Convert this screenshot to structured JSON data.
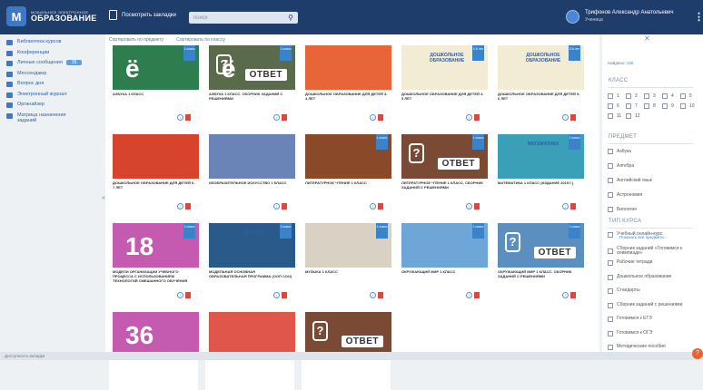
{
  "app": {
    "logo_small": "МОБИЛЬНОЕ ЭЛЕКТРОННОЕ",
    "logo_big": "ОБРАЗОВАНИЕ"
  },
  "header": {
    "bookmarks_label": "Посмотреть закладки",
    "search_placeholder": "поиск",
    "user_name": "Трифонов Александр Анатольевич",
    "user_role": "Ученица"
  },
  "sidebar": {
    "items": [
      {
        "label": "Библиотека курсов",
        "icon": "library-icon"
      },
      {
        "label": "Конференции",
        "icon": "conference-icon"
      },
      {
        "label": "Личные сообщения",
        "icon": "messages-icon",
        "badge": "15"
      },
      {
        "label": "Мессенджер",
        "icon": "messenger-icon"
      },
      {
        "label": "Вопрос дня",
        "icon": "question-icon"
      },
      {
        "label": "Электронный журнал",
        "icon": "journal-icon"
      },
      {
        "label": "Органайзер",
        "icon": "organizer-icon"
      },
      {
        "label": "Матрица назначения заданий",
        "icon": "matrix-icon"
      }
    ]
  },
  "sort": {
    "by_subject": "Сортировать по предмету",
    "by_class": "Сортировать по классу"
  },
  "cards": [
    {
      "title": "АЗБУКА 1 КЛАСС",
      "bg": "#2e7d4f",
      "big": "ё",
      "answer": false,
      "corner": "1 класс"
    },
    {
      "title": "АЗБУКА 1 КЛАСС. СБОРНИК ЗАДАНИЙ С РЕШЕНИЯМИ",
      "bg": "#5a6b4c",
      "big": "ё",
      "answer": true,
      "corner": "1 класс"
    },
    {
      "title": "ДОШКОЛЬНОЕ ОБРАЗОВАНИЕ ДЛЯ ДЕТЕЙ 3-4 ЛЕТ",
      "bg": "#e8653a",
      "big": "",
      "answer": false,
      "corner": ""
    },
    {
      "title": "ДОШКОЛЬНОЕ ОБРАЗОВАНИЕ ДЛЯ ДЕТЕЙ 4-5 ЛЕТ",
      "bg": "#f3ecd4",
      "big": "ДОШКОЛЬНОЕ ОБРАЗОВАНИЕ",
      "answer": false,
      "corner": "4-5 лет"
    },
    {
      "title": "ДОШКОЛЬНОЕ ОБРАЗОВАНИЕ ДЛЯ ДЕТЕЙ 5-6 ЛЕТ",
      "bg": "#f3ecd4",
      "big": "ДОШКОЛЬНОЕ ОБРАЗОВАНИЕ",
      "answer": false,
      "corner": "5-6 лет"
    },
    {
      "title": "ДОШКОЛЬНОЕ ОБРАЗОВАНИЕ ДЛЯ ДЕТЕЙ 6-7 ЛЕТ",
      "bg": "#d8432e",
      "big": "",
      "answer": false,
      "corner": ""
    },
    {
      "title": "ИЗОБРАЗИТЕЛЬНОЕ ИСКУССТВО 1 КЛАСС",
      "bg": "#6b84b8",
      "big": "",
      "answer": false,
      "corner": ""
    },
    {
      "title": "ЛИТЕРАТУРНОЕ ЧТЕНИЕ 1 КЛАСС",
      "bg": "#8a4a2a",
      "big": "",
      "answer": false,
      "corner": "1 класс"
    },
    {
      "title": "ЛИТЕРАТУРНОЕ ЧТЕНИЕ 1 КЛАСС. СБОРНИК ЗАДАНИЙ С РЕШЕНИЯМИ",
      "bg": "#7a4a35",
      "big": "",
      "answer": true,
      "corner": "1 класс"
    },
    {
      "title": "МАТЕМАТИКА 1 КЛАСС (ИЗДАНИЕ 2019 Г.)",
      "bg": "#3aa0b8",
      "big": "МАТЕМАТИКА",
      "answer": false,
      "corner": "1 класс"
    },
    {
      "title": "МОДЕЛИ ОРГАНИЗАЦИИ УЧЕБНОГО ПРОЦЕССА С ИСПОЛЬЗОВАНИЕМ ТЕХНОЛОГИЙ СМЕШАННОГО ОБУЧЕНИЯ",
      "bg": "#c45bb0",
      "big": "18",
      "answer": false,
      "corner": "1 класс"
    },
    {
      "title": "МОДЕЛЬНАЯ ОСНОВНАЯ ОБРАЗОВАТЕЛЬНАЯ ПРОГРАММА (ООП СОО)",
      "bg": "#2a5a8a",
      "big": "ООП СОО",
      "answer": false,
      "corner": "1 класс"
    },
    {
      "title": "МУЗЫКА 1 КЛАСС",
      "bg": "#d9d2c4",
      "big": "",
      "answer": false,
      "corner": "1 класс"
    },
    {
      "title": "ОКРУЖАЮЩИЙ МИР 1 КЛАСС",
      "bg": "#6fa6d8",
      "big": "",
      "answer": false,
      "corner": "1 класс"
    },
    {
      "title": "ОКРУЖАЮЩИЙ МИР 1 КЛАСС. СБОРНИК ЗАДАНИЙ С РЕШЕНИЯМИ",
      "bg": "#5a8fbf",
      "big": "",
      "answer": true,
      "corner": "1 класс"
    },
    {
      "title": "",
      "bg": "#c45bb0",
      "big": "36",
      "answer": false,
      "corner": ""
    },
    {
      "title": "",
      "bg": "#e0564a",
      "big": "",
      "answer": false,
      "corner": ""
    },
    {
      "title": "",
      "bg": "#7a4a35",
      "big": "",
      "answer": true,
      "corner": ""
    }
  ],
  "answer_label": "ОТВЕТ",
  "filters": {
    "close": "✕",
    "found_label": "Найдено:",
    "found_count": "140",
    "class_heading": "КЛАСС",
    "classes": [
      "1",
      "2",
      "3",
      "4",
      "5",
      "6",
      "7",
      "8",
      "9",
      "10",
      "11",
      "12"
    ],
    "subject_heading": "ПРЕДМЕТ",
    "subjects": [
      "Азбука",
      "Алгебра",
      "Английский язык",
      "Астрономия",
      "Биология"
    ],
    "show_all": "Показать все предметы",
    "type_heading": "ТИП КУРСА",
    "types": [
      "Учебный онлайн-курс",
      "Сборник заданий «Готовимся к олимпиаде»",
      "Рабочие тетради",
      "Дошкольное образование",
      "Стандарты",
      "Сборник заданий с решениями",
      "Готовимся к ЕГЭ",
      "Готовимся к ОГЭ",
      "Методические пособия"
    ]
  },
  "footer": {
    "text": "Доступность вкладки"
  },
  "colors": {
    "topbar": "#1f3d6b",
    "accent": "#3b83c9",
    "flag": "#d9493f"
  }
}
